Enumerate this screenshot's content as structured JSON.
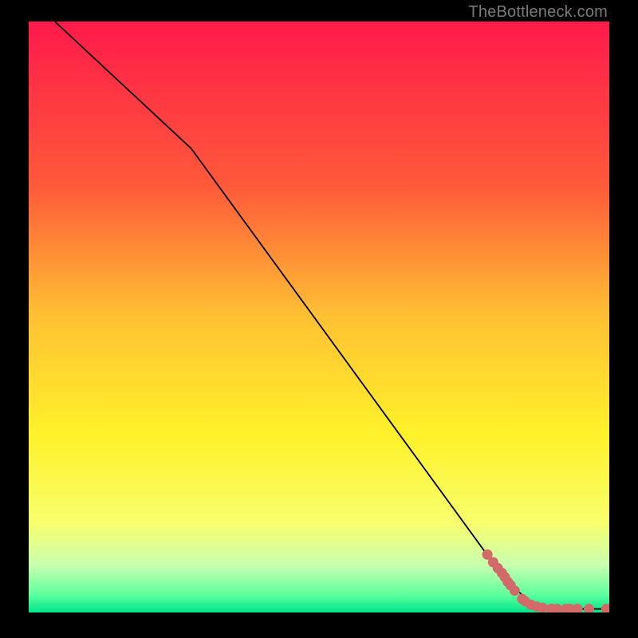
{
  "watermark": "TheBottleneck.com",
  "chart_data": {
    "type": "line",
    "title": "",
    "xlabel": "",
    "ylabel": "",
    "xlim": [
      0,
      100
    ],
    "ylim": [
      0,
      100
    ],
    "grid": false,
    "gradient": {
      "stops": [
        {
          "offset": 0.0,
          "color": "#ff1a4b"
        },
        {
          "offset": 0.28,
          "color": "#ff5a3a"
        },
        {
          "offset": 0.5,
          "color": "#ffc133"
        },
        {
          "offset": 0.7,
          "color": "#fff22a"
        },
        {
          "offset": 0.85,
          "color": "#f7ff6e"
        },
        {
          "offset": 0.92,
          "color": "#c8ffb0"
        },
        {
          "offset": 0.97,
          "color": "#5eff9d"
        },
        {
          "offset": 1.0,
          "color": "#00e58a"
        }
      ]
    },
    "series": [
      {
        "name": "curve",
        "type": "line",
        "color": "#000000",
        "stroke_width": 1.8,
        "x": [
          4.5,
          28.0,
          82.5,
          86.5,
          90.0,
          100.0
        ],
        "y": [
          100.0,
          78.5,
          5.0,
          1.8,
          0.6,
          0.6
        ]
      },
      {
        "name": "markers",
        "type": "scatter",
        "color": "#d26a6a",
        "radius": 6.5,
        "x": [
          79.0,
          80.0,
          80.8,
          81.5,
          82.0,
          82.5,
          83.0,
          83.7,
          85.0,
          85.5,
          86.5,
          87.5,
          88.5,
          90.0,
          91.0,
          92.5,
          93.2,
          94.5,
          96.5,
          99.5
        ],
        "y": [
          9.8,
          8.5,
          7.5,
          6.7,
          6.0,
          5.2,
          4.6,
          3.7,
          2.3,
          1.9,
          1.3,
          1.0,
          0.8,
          0.6,
          0.6,
          0.6,
          0.6,
          0.6,
          0.6,
          0.6
        ]
      }
    ]
  }
}
